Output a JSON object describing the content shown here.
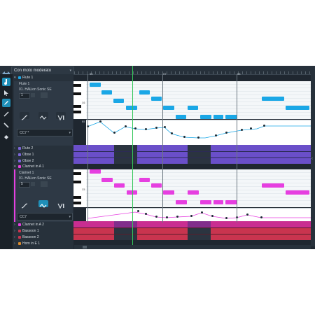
{
  "header": {
    "tempo_label": "Con moto moderato",
    "bar_numbers": [
      "56",
      "57",
      "58"
    ]
  },
  "toolbar": {
    "tools": [
      "arrow-tool",
      "object-select-tool",
      "draw-tool",
      "line-tool",
      "knife-tool",
      "eraser-tool"
    ],
    "active_tool": "draw-tool"
  },
  "tracks_top": [
    {
      "name": "Flute 1",
      "expanded": true
    }
  ],
  "flute": {
    "track_name": "Flute 1",
    "instrument": "01. HALion Sonic SE",
    "channel": "1",
    "cc_label": "CC7 *",
    "octave_label": "C6",
    "octave_label_low": "B5"
  },
  "tracks_mid": [
    {
      "name": "Flute 2"
    },
    {
      "name": "Oboe 1"
    },
    {
      "name": "Oboe 2"
    },
    {
      "name": "Clarinet in A 1"
    }
  ],
  "clarinet": {
    "track_name": "Clarinet 1",
    "instrument": "01. HALion Sonic SE",
    "channel": "5",
    "cc_label": "CC7",
    "octave_label": "C5"
  },
  "tracks_bottom": [
    {
      "name": "Clarinet in A 2"
    },
    {
      "name": "Bassoon 1"
    },
    {
      "name": "Bassoon 2"
    },
    {
      "name": "Horn in E 1"
    }
  ],
  "colors": {
    "flute_note": "#1aa7e6",
    "clarinet_note": "#e63fe0",
    "woodwind_lane": "#6a4fc9",
    "bassoon_lane": "#c9344f",
    "playhead": "#34c759",
    "panel": "#1f2730"
  }
}
